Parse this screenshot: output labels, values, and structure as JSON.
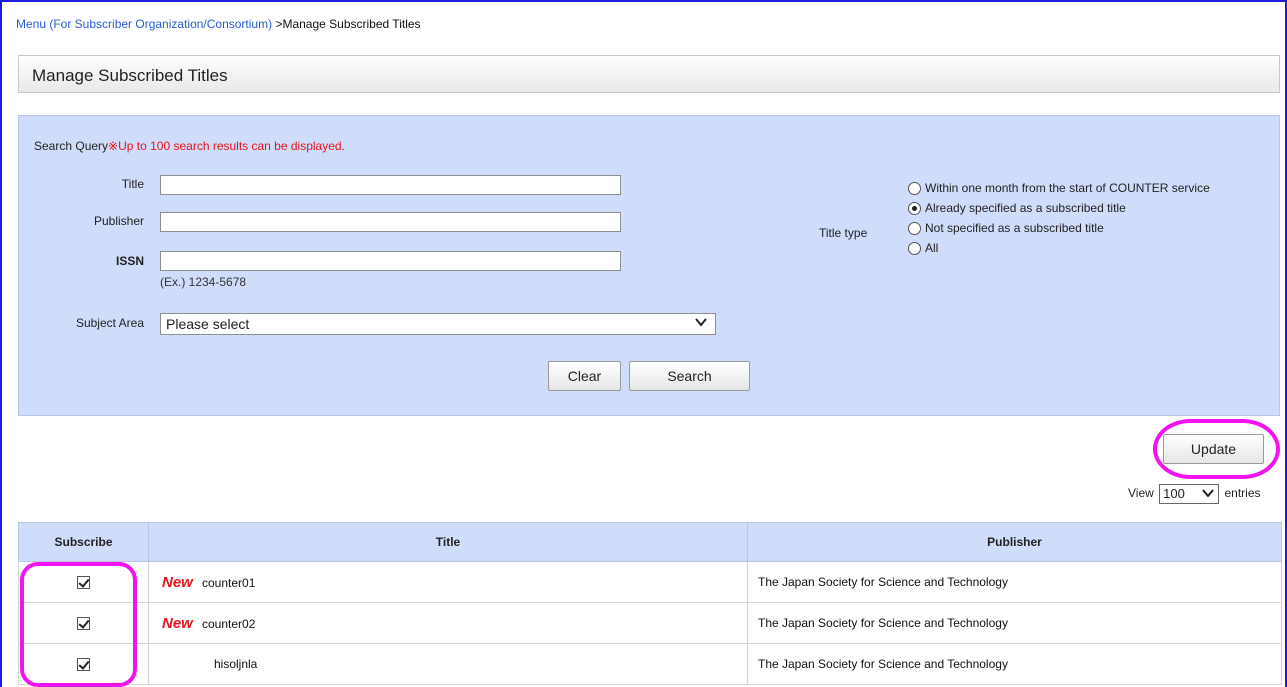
{
  "breadcrumb": {
    "menu_link": "Menu (For Subscriber Organization/Consortium)",
    "separator": " >",
    "current": "Manage Subscribed Titles"
  },
  "page_title": "Manage Subscribed Titles",
  "search": {
    "query_label": "Search Query",
    "note": "※Up to 100 search results can be displayed.",
    "title_label": "Title",
    "title_value": "",
    "publisher_label": "Publisher",
    "publisher_value": "",
    "issn_label": "ISSN",
    "issn_value": "",
    "issn_hint": "(Ex.) 1234-5678",
    "subject_label": "Subject Area",
    "subject_selected": "Please select",
    "title_type_label": "Title type",
    "title_type_options": [
      "Within one month from the start of COUNTER service",
      "Already specified as a subscribed title",
      "Not specified as a subscribed title",
      "All"
    ],
    "title_type_selected_index": 1,
    "clear_label": "Clear",
    "search_label": "Search"
  },
  "update_label": "Update",
  "view": {
    "prefix": "View",
    "value": "100",
    "suffix": "entries"
  },
  "table": {
    "headers": [
      "Subscribe",
      "Title",
      "Publisher"
    ],
    "rows": [
      {
        "checked": true,
        "new": "New",
        "title": "counter01",
        "publisher": "The Japan Society for Science and Technology"
      },
      {
        "checked": true,
        "new": "New",
        "title": "counter02",
        "publisher": "The Japan Society for Science and Technology"
      },
      {
        "checked": true,
        "new": "",
        "title": "hisoljnla",
        "publisher": "The Japan Society for Science and Technology"
      }
    ]
  },
  "colors": {
    "panel_bg": "#cfdcfa",
    "note_red": "#e8141b",
    "highlight_magenta": "#f213f2",
    "frame_blue": "#1a1ae0",
    "link_blue": "#2a5bd7"
  }
}
